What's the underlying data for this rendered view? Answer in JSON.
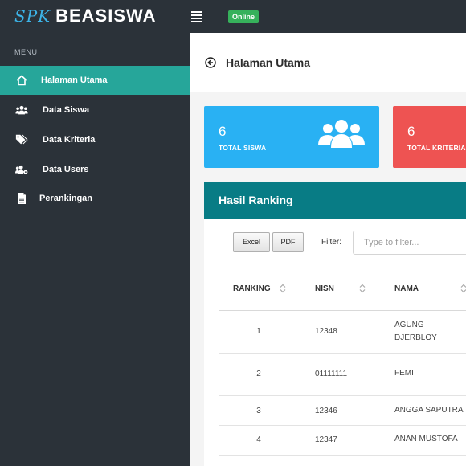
{
  "brand": {
    "prefix": "SPK",
    "name": "BEASISWA"
  },
  "status_badge": "Online",
  "sidebar": {
    "menu_label": "MENU",
    "items": [
      {
        "label": "Halaman Utama",
        "icon": "home-icon",
        "active": true
      },
      {
        "label": "Data Siswa",
        "icon": "users-icon",
        "active": false
      },
      {
        "label": "Data Kriteria",
        "icon": "tags-icon",
        "active": false
      },
      {
        "label": "Data Users",
        "icon": "users-cog-icon",
        "active": false
      },
      {
        "label": "Perankingan",
        "icon": "file-icon",
        "active": false
      }
    ]
  },
  "header": {
    "title": "Halaman Utama"
  },
  "cards": [
    {
      "value": "6",
      "label": "TOTAL SISWA",
      "color": "#29b1f3"
    },
    {
      "value": "6",
      "label": "TOTAL KRITERIA",
      "color": "#ee5352"
    }
  ],
  "ranking": {
    "title": "Hasil Ranking",
    "export_buttons": {
      "excel": "Excel",
      "pdf": "PDF"
    },
    "filter_label": "Filter:",
    "filter_placeholder": "Type to filter...",
    "columns": [
      "RANKING",
      "NISN",
      "NAMA"
    ],
    "rows": [
      {
        "rank": "1",
        "nisn": "12348",
        "nama": "AGUNG DJERBLOY"
      },
      {
        "rank": "2",
        "nisn": "01111111",
        "nama": "FEMI"
      },
      {
        "rank": "3",
        "nisn": "12346",
        "nama": "ANGGA SAPUTRA"
      },
      {
        "rank": "4",
        "nisn": "12347",
        "nama": "ANAN MUSTOFA"
      }
    ]
  },
  "colors": {
    "sidebar": "#2b3239",
    "accent": "#26a69a",
    "panel_header": "#087c85"
  }
}
